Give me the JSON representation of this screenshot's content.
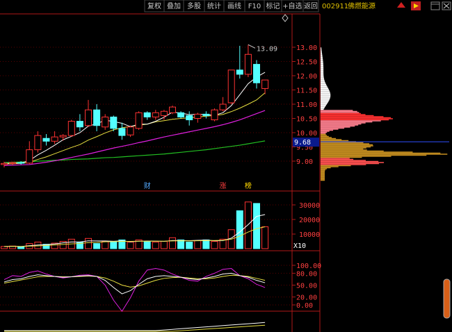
{
  "toolbar": {
    "items": [
      "复权",
      "叠加",
      "多股",
      "统计",
      "画线",
      "F10",
      "标记",
      "+自选",
      "返回"
    ],
    "stock_code": "002911",
    "stock_name": "佛燃能源"
  },
  "chart_data": [
    {
      "type": "candlestick",
      "name": "price",
      "y_ticks": [
        "13.00",
        "12.50",
        "12.00",
        "11.50",
        "11.00",
        "10.50",
        "10.00",
        "9.50",
        "9.00"
      ],
      "ylim": [
        8.72,
        13.55
      ],
      "high_label": "13.09",
      "current_price_label": "9.68",
      "current_price": 9.68,
      "event_markers": [
        {
          "index": 17,
          "label": "财"
        },
        {
          "index": 26,
          "label": "涨"
        },
        {
          "index": 29,
          "label": "榜"
        }
      ],
      "candles": [
        {
          "o": 8.88,
          "h": 8.98,
          "l": 8.78,
          "c": 8.92
        },
        {
          "o": 8.92,
          "h": 8.98,
          "l": 8.86,
          "c": 8.95
        },
        {
          "o": 8.95,
          "h": 9.0,
          "l": 8.88,
          "c": 8.93
        },
        {
          "o": 8.93,
          "h": 9.7,
          "l": 8.9,
          "c": 9.4
        },
        {
          "o": 9.4,
          "h": 10.05,
          "l": 9.3,
          "c": 9.9
        },
        {
          "o": 9.8,
          "h": 9.95,
          "l": 9.55,
          "c": 9.7
        },
        {
          "o": 9.7,
          "h": 10.05,
          "l": 9.6,
          "c": 9.85
        },
        {
          "o": 9.85,
          "h": 9.95,
          "l": 9.72,
          "c": 9.9
        },
        {
          "o": 9.9,
          "h": 10.45,
          "l": 9.85,
          "c": 10.4
        },
        {
          "o": 10.4,
          "h": 10.65,
          "l": 10.05,
          "c": 10.2
        },
        {
          "o": 10.25,
          "h": 11.15,
          "l": 10.2,
          "c": 10.8
        },
        {
          "o": 10.8,
          "h": 11.0,
          "l": 10.05,
          "c": 10.25
        },
        {
          "o": 10.2,
          "h": 10.65,
          "l": 10.1,
          "c": 10.55
        },
        {
          "o": 10.55,
          "h": 10.6,
          "l": 10.05,
          "c": 10.15
        },
        {
          "o": 10.15,
          "h": 10.35,
          "l": 9.75,
          "c": 9.9
        },
        {
          "o": 9.92,
          "h": 10.25,
          "l": 9.85,
          "c": 10.2
        },
        {
          "o": 10.15,
          "h": 10.75,
          "l": 10.1,
          "c": 10.7
        },
        {
          "o": 10.7,
          "h": 10.75,
          "l": 10.45,
          "c": 10.55
        },
        {
          "o": 10.55,
          "h": 10.8,
          "l": 10.45,
          "c": 10.7
        },
        {
          "o": 10.6,
          "h": 10.8,
          "l": 10.45,
          "c": 10.75
        },
        {
          "o": 10.7,
          "h": 10.95,
          "l": 10.65,
          "c": 10.9
        },
        {
          "o": 10.7,
          "h": 10.75,
          "l": 10.5,
          "c": 10.55
        },
        {
          "o": 10.6,
          "h": 10.75,
          "l": 10.25,
          "c": 10.45
        },
        {
          "o": 10.5,
          "h": 10.7,
          "l": 10.35,
          "c": 10.65
        },
        {
          "o": 10.65,
          "h": 10.75,
          "l": 10.5,
          "c": 10.6
        },
        {
          "o": 10.45,
          "h": 10.85,
          "l": 10.4,
          "c": 10.8
        },
        {
          "o": 10.8,
          "h": 11.25,
          "l": 10.75,
          "c": 11.0
        },
        {
          "o": 11.05,
          "h": 12.2,
          "l": 11.0,
          "c": 12.2
        },
        {
          "o": 12.2,
          "h": 13.05,
          "l": 11.9,
          "c": 12.05
        },
        {
          "o": 12.05,
          "h": 13.09,
          "l": 11.95,
          "c": 12.75
        },
        {
          "o": 12.4,
          "h": 12.55,
          "l": 11.55,
          "c": 11.75
        },
        {
          "o": 11.55,
          "h": 11.85,
          "l": 11.35,
          "c": 11.85
        }
      ],
      "ma5": [
        8.92,
        8.93,
        8.94,
        9.02,
        9.22,
        9.38,
        9.56,
        9.75,
        9.87,
        10.0,
        10.23,
        10.31,
        10.44,
        10.39,
        10.33,
        10.21,
        10.3,
        10.3,
        10.4,
        10.54,
        10.72,
        10.69,
        10.63,
        10.65,
        10.63,
        10.61,
        10.7,
        10.95,
        11.33,
        11.72,
        11.95,
        12.12
      ],
      "ma10": [
        8.9,
        8.91,
        8.92,
        8.96,
        9.06,
        9.15,
        9.26,
        9.37,
        9.48,
        9.58,
        9.74,
        9.86,
        9.99,
        10.1,
        10.17,
        10.22,
        10.26,
        10.3,
        10.38,
        10.42,
        10.47,
        10.5,
        10.52,
        10.55,
        10.58,
        10.6,
        10.64,
        10.74,
        10.86,
        11.0,
        11.15,
        11.4
      ],
      "ma20": [
        8.85,
        8.86,
        8.87,
        8.88,
        8.92,
        8.96,
        9.01,
        9.07,
        9.13,
        9.19,
        9.25,
        9.32,
        9.39,
        9.46,
        9.52,
        9.58,
        9.65,
        9.71,
        9.78,
        9.85,
        9.91,
        9.97,
        10.03,
        10.09,
        10.15,
        10.21,
        10.28,
        10.36,
        10.45,
        10.56,
        10.67,
        10.78
      ],
      "ma60": [
        8.95,
        8.96,
        8.97,
        8.98,
        9.0,
        9.01,
        9.03,
        9.04,
        9.06,
        9.07,
        9.08,
        9.1,
        9.12,
        9.13,
        9.15,
        9.17,
        9.19,
        9.21,
        9.23,
        9.25,
        9.28,
        9.31,
        9.34,
        9.37,
        9.4,
        9.44,
        9.48,
        9.52,
        9.56,
        9.61,
        9.66,
        9.71
      ]
    },
    {
      "type": "bar",
      "name": "volume",
      "y_ticks": [
        "30000",
        "20000",
        "10000"
      ],
      "unit_label": "X10",
      "ylim": [
        0,
        34000
      ],
      "values": [
        1500,
        1800,
        1200,
        3500,
        4500,
        3000,
        3800,
        5000,
        6500,
        4500,
        7000,
        3500,
        5000,
        4800,
        6000,
        4500,
        6000,
        5000,
        4500,
        5000,
        7500,
        6000,
        4500,
        5500,
        6000,
        5000,
        6500,
        13000,
        26000,
        32000,
        31000,
        15000
      ],
      "ma5": [
        1500,
        1650,
        1500,
        2000,
        2500,
        2800,
        3200,
        3960,
        4560,
        4560,
        5360,
        5300,
        5300,
        5060,
        5360,
        4760,
        5060,
        5260,
        5160,
        5000,
        5600,
        5600,
        5500,
        5700,
        5900,
        5400,
        5500,
        7200,
        11400,
        16500,
        22100,
        23400
      ],
      "ma10": [
        1500,
        1600,
        1500,
        1700,
        1900,
        2200,
        2500,
        2900,
        3300,
        3600,
        4100,
        4300,
        4700,
        4800,
        5000,
        5000,
        5100,
        5100,
        5100,
        5100,
        5300,
        5400,
        5300,
        5400,
        5500,
        5600,
        5700,
        6500,
        8600,
        11400,
        13700,
        15000
      ]
    },
    {
      "type": "line",
      "name": "kdj",
      "y_ticks": [
        "100.00",
        "80.00",
        "50.00",
        "20.00",
        "0.00"
      ],
      "ylim": [
        0,
        100
      ],
      "k": [
        58,
        64,
        66,
        72,
        76,
        74,
        72,
        70,
        71,
        73,
        74,
        72,
        62,
        44,
        28,
        36,
        52,
        66,
        72,
        74,
        72,
        70,
        66,
        64,
        68,
        72,
        78,
        80,
        74,
        70,
        62,
        56
      ],
      "d": [
        55,
        59,
        63,
        67,
        71,
        72,
        72,
        71,
        71,
        72,
        73,
        72,
        68,
        60,
        50,
        45,
        48,
        55,
        62,
        67,
        69,
        70,
        68,
        66,
        66,
        68,
        72,
        75,
        74,
        72,
        67,
        62
      ],
      "j": [
        64,
        74,
        72,
        82,
        86,
        78,
        72,
        68,
        71,
        75,
        76,
        72,
        50,
        12,
        -16,
        18,
        60,
        88,
        92,
        88,
        78,
        70,
        62,
        60,
        72,
        80,
        90,
        92,
        74,
        66,
        52,
        44
      ]
    }
  ]
}
